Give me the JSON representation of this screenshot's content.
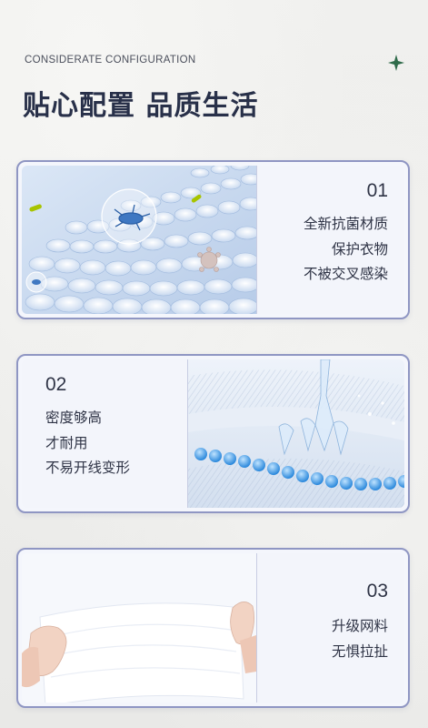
{
  "header": {
    "eyebrow": "CONSIDERATE CONFIGURATION",
    "title": "贴心配置 品质生活",
    "sparkle_icon": "sparkle-icon",
    "sparkle_color": "#2f6b4a"
  },
  "colors": {
    "card_border": "#8f96c3",
    "card_bg": "#f4f6fc",
    "text": "#2f3446"
  },
  "features": [
    {
      "number": "01",
      "lines": [
        "全新抗菌材质",
        "保护衣物",
        "不被交叉感染"
      ],
      "image": "antibacterial-fabric-image"
    },
    {
      "number": "02",
      "lines": [
        "密度够高",
        "才耐用",
        "不易开线变形"
      ],
      "image": "high-density-mesh-image"
    },
    {
      "number": "03",
      "lines": [
        "升级网料",
        "无惧拉扯"
      ],
      "image": "stretch-mesh-image"
    }
  ]
}
